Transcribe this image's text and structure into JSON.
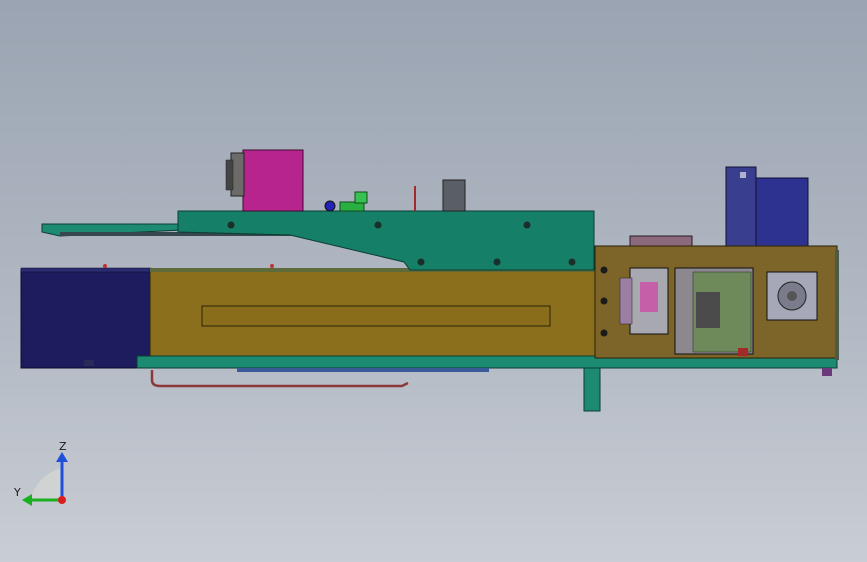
{
  "viewport": {
    "background_top": "#9aa4b2",
    "background_bottom": "#c9cdd4"
  },
  "triad": {
    "z_label": "Z",
    "y_label": "Y",
    "z_color": "#1f4fd8",
    "y_color": "#19b01f",
    "x_color": "#d81e1e"
  },
  "model": {
    "colors": {
      "main_frame": "#8c6f1c",
      "green_panel": "#167f68",
      "navy_box": "#1c1c5e",
      "magenta_motor": "#b8248e",
      "blue_housing": "#3a3e8f",
      "bronze_panel": "#7d6428",
      "gray_cylinder": "#5a5e66",
      "copper_cable": "#8a3a3a"
    }
  }
}
